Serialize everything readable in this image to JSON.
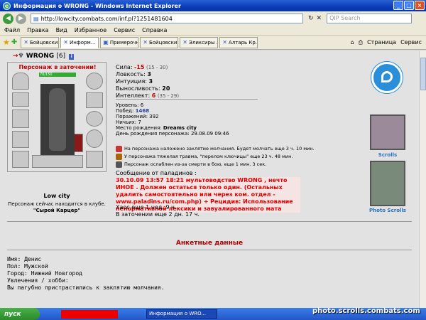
{
  "window": {
    "title": "Информация о WRONG - Windows Internet Explorer"
  },
  "address": {
    "url": "http://lowcity.combats.com/inf.pl?1251481604",
    "search_placeholder": "QIP Search"
  },
  "menu": [
    "Файл",
    "Правка",
    "Вид",
    "Избранное",
    "Сервис",
    "Справка"
  ],
  "tabs": [
    "Бойцовски...",
    "Информ...",
    "Примерочн...",
    "Бойцовски...",
    "Эликсиры ...",
    "Алтарь Кр..."
  ],
  "tab_tools": {
    "page": "Страница",
    "service": "Сервис"
  },
  "character": {
    "nick": "WRONG",
    "level": "[6]",
    "info_badge": "i",
    "status": "Персонаж в заточении!",
    "hp": "70/150",
    "city": "Low city",
    "club_line": "Персонаж сейчас находится в клубе.",
    "room": "\"Сырой Карцер\""
  },
  "stats": {
    "strength": {
      "label": "Сила:",
      "value": "-15",
      "note": "(15 - 30)"
    },
    "agility": {
      "label": "Ловкость:",
      "value": "3"
    },
    "intuition": {
      "label": "Интуиция:",
      "value": "3"
    },
    "endurance": {
      "label": "Выносливость:",
      "value": "20"
    },
    "intellect": {
      "label": "Интеллект:",
      "value": "6",
      "note": "(35 - 29)"
    }
  },
  "bio": {
    "level": "Уровень: 6",
    "wins_label": "Побед:",
    "wins": "1468",
    "losses": "Поражений: 392",
    "draws": "Ничьих: 7",
    "birthplace_label": "Место рождения:",
    "birthplace": "Dreams city",
    "birthday": "День рождения персонажа: 29.08.09 09:46"
  },
  "effects": [
    "На персонажа наложено заклятие молчания. Будет молчать еще 3 ч. 10 мин.",
    "У персонажа тяжелая травма, \"перелом ключицы\" еще 23 ч. 48 мин.",
    "Персонаж ослаблен из-за смерти в бою, еще 1 мин. 3 сек."
  ],
  "message": {
    "heading": "Сообщение от паладинов :",
    "text": "30.10.09 13:57 18:21 мультоводство WRONG , нечто ИНОЕ . Должен остаться только один. (Остальных удалить самостоятельно или через ком. отдел - www.paladins.ru/com.php) + Рецидив: Использование ненормативной лексики и завуалированного мата"
  },
  "chaos": {
    "line1": "Хаос еще 1 нед. 9 ч.",
    "line2": "В заточении еще 2 дн. 17 ч."
  },
  "anketa": {
    "title": "Анкетные данные",
    "name": "Имя: Денис",
    "sex": "Пол: Мужской",
    "city": "Город: Нижний Новгород",
    "hobbies": "Увлечения / хобби:",
    "hobbies_text": "Вы пагубно пристрастились к заклятию молчания."
  },
  "side": {
    "scrolls": "Scrolls",
    "photo_scrolls": "Photo Scrolls"
  },
  "taskbar": {
    "start": "пуск",
    "task": "Информация о WRO..."
  },
  "watermark": "photo.scrolls.combats.com"
}
